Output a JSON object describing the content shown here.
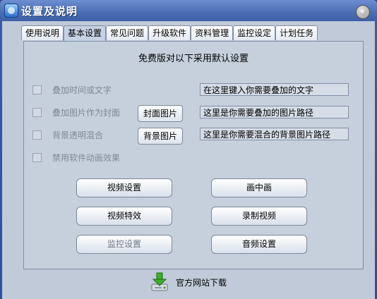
{
  "window": {
    "title": "设置及说明"
  },
  "tabs": [
    {
      "label": "使用说明",
      "active": false
    },
    {
      "label": "基本设置",
      "active": true
    },
    {
      "label": "常见问题",
      "active": false
    },
    {
      "label": "升级软件",
      "active": false
    },
    {
      "label": "资料管理",
      "active": false
    },
    {
      "label": "监控设定",
      "active": false
    },
    {
      "label": "计划任务",
      "active": false
    }
  ],
  "panel": {
    "heading": "免费版对以下采用默认设置",
    "options": [
      {
        "label": "叠加时间或文字",
        "checked": false
      },
      {
        "label": "叠加图片作为封面",
        "checked": false
      },
      {
        "label": "背景透明混合",
        "checked": false
      },
      {
        "label": "禁用软件动画效果",
        "checked": false
      }
    ],
    "fields": {
      "text_overlay": "在这里键入你需要叠加的文字",
      "cover_image_path": "这里是你需要叠加的图片路径",
      "blend_image_path": "这里是你需要混合的背景图片路径"
    },
    "side_buttons": {
      "cover_image": "封面图片",
      "background_image": "背景图片"
    },
    "buttons": {
      "video_settings": "视频设置",
      "picture_in_picture": "画中画",
      "video_effects": "视频特效",
      "record_video": "录制视频",
      "monitor_settings": "监控设置",
      "audio_settings": "音频设置"
    }
  },
  "footer": {
    "download_label": "官方网站下载"
  }
}
